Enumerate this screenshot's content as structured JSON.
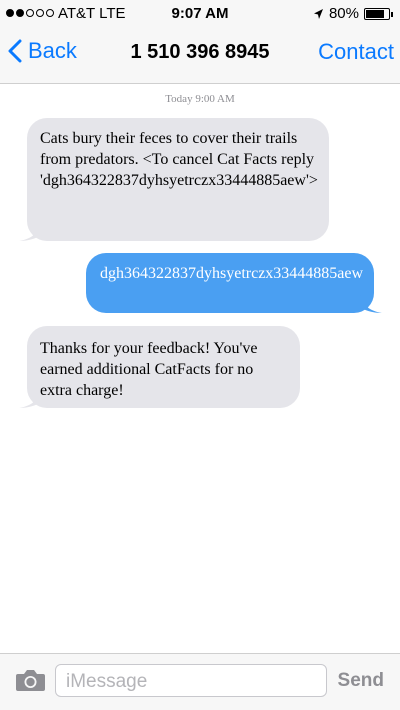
{
  "status_bar": {
    "carrier": "AT&T LTE",
    "time": "9:07 AM",
    "battery_percent": "80%",
    "battery_level": 0.8,
    "signal_bars_filled": 2,
    "signal_bars_total": 5
  },
  "nav": {
    "back_label": "Back",
    "title": "1 510 396 8945",
    "contact_label": "Contact"
  },
  "thread": {
    "timestamp": "Today 9:00 AM",
    "messages": [
      {
        "direction": "incoming",
        "text": "Cats bury their feces to cover their trails from predators. <To cancel Cat Facts reply 'dgh364322837dyhsyetrczx33444885aew'>"
      },
      {
        "direction": "outgoing",
        "text": "dgh364322837dyhsyetrczx33444885aew"
      },
      {
        "direction": "incoming",
        "text": "Thanks for your feedback! You've earned additional CatFacts for no extra charge!"
      }
    ]
  },
  "composer": {
    "placeholder": "iMessage",
    "send_label": "Send"
  },
  "colors": {
    "accent": "#0a7aff",
    "incoming_bubble": "#e5e5ea",
    "outgoing_bubble": "#4a9ff2"
  },
  "icons": [
    "signal-dots-icon",
    "chevron-left-icon",
    "location-arrow-icon",
    "battery-icon",
    "camera-icon"
  ]
}
